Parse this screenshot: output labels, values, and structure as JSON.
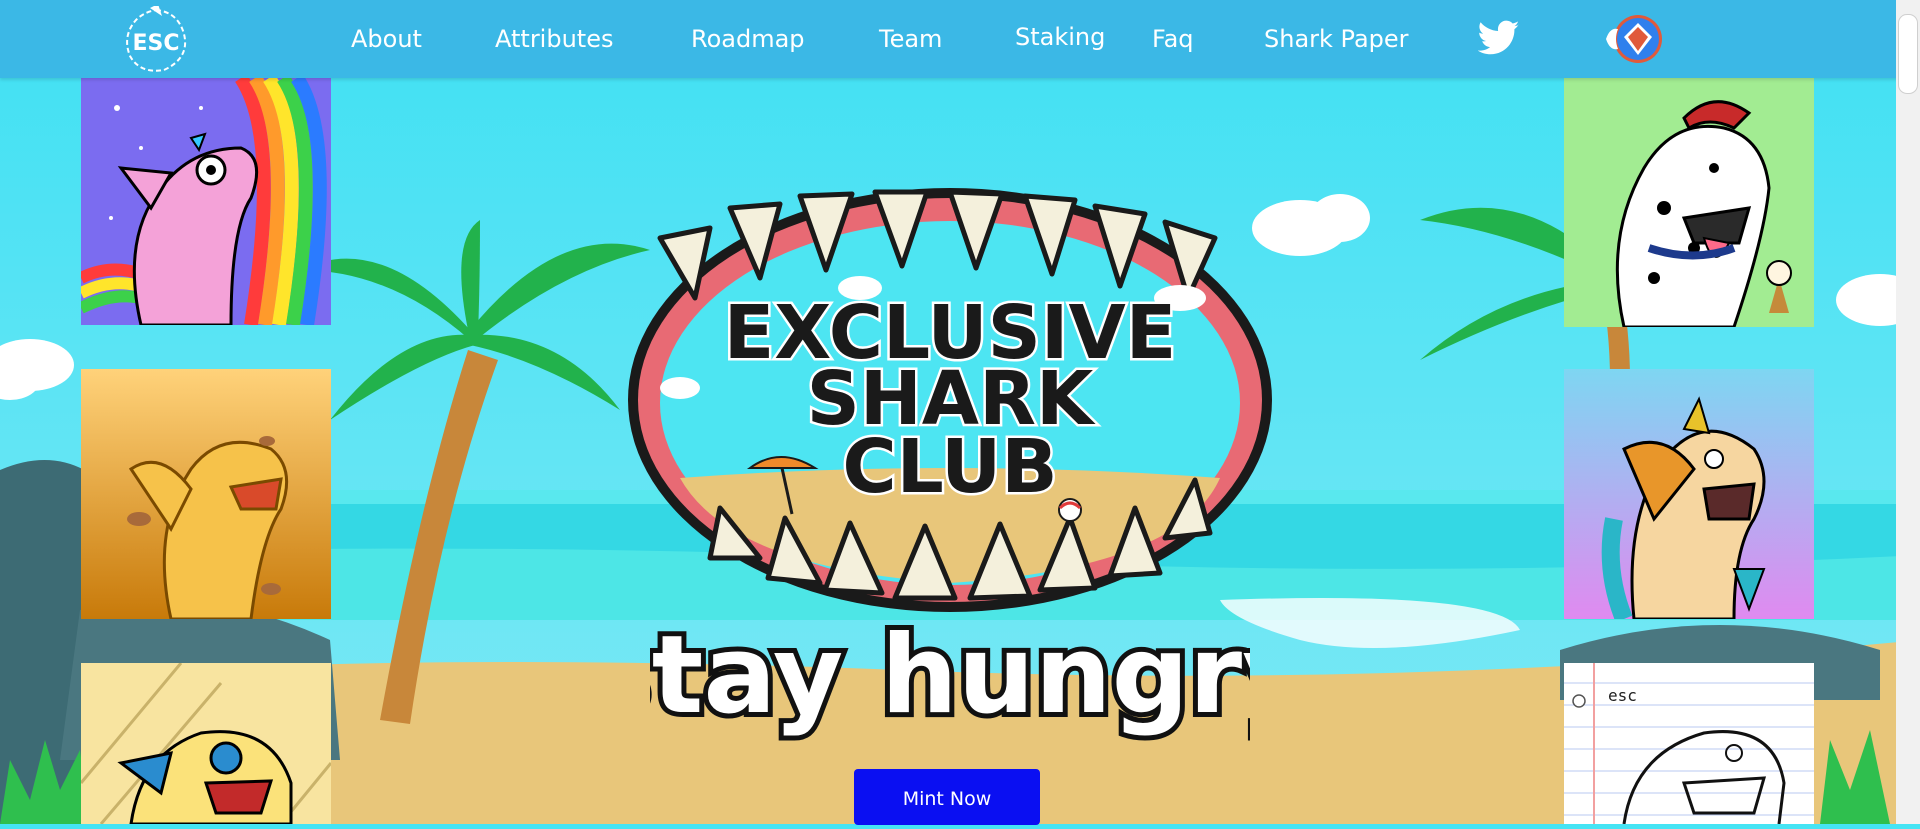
{
  "nav": {
    "logo_text": "ESC",
    "links": [
      "About",
      "Attributes",
      "Roadmap",
      "Team",
      "Staking",
      "Faq",
      "Shark Paper"
    ],
    "twitter_icon": "twitter-icon",
    "opensea_icon": "opensea-icon"
  },
  "hero": {
    "title_line1": "EXCLUSIVE",
    "title_line2": "SHARK",
    "title_line3": "CLUB",
    "tagline": "stay hungry",
    "mint_label": "Mint Now"
  },
  "cards": {
    "notebook_text": "esc"
  },
  "colors": {
    "nav_bg": "#3bb8e6",
    "sky": "#45e4f4",
    "sand": "#e8c67a",
    "mint_button": "#0a0ff2"
  }
}
